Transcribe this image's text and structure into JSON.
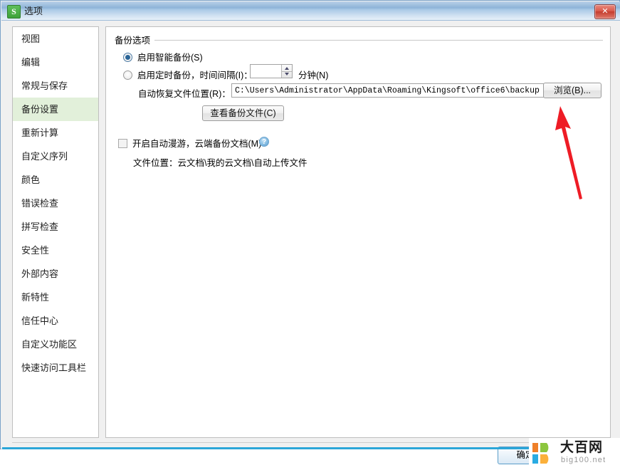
{
  "window": {
    "title": "选项",
    "app_icon": "S",
    "close_label": "✕"
  },
  "sidebar": {
    "items": [
      {
        "label": "视图",
        "selected": false
      },
      {
        "label": "编辑",
        "selected": false
      },
      {
        "label": "常规与保存",
        "selected": false
      },
      {
        "label": "备份设置",
        "selected": true
      },
      {
        "label": "重新计算",
        "selected": false
      },
      {
        "label": "自定义序列",
        "selected": false
      },
      {
        "label": "颜色",
        "selected": false
      },
      {
        "label": "错误检查",
        "selected": false
      },
      {
        "label": "拼写检查",
        "selected": false
      },
      {
        "label": "安全性",
        "selected": false
      },
      {
        "label": "外部内容",
        "selected": false
      },
      {
        "label": "新特性",
        "selected": false
      },
      {
        "label": "信任中心",
        "selected": false
      },
      {
        "label": "自定义功能区",
        "selected": false
      },
      {
        "label": "快速访问工具栏",
        "selected": false
      }
    ]
  },
  "main": {
    "group_title": "备份选项",
    "smart_backup": {
      "label": "启用智能备份(S)",
      "checked": true
    },
    "timed_backup": {
      "label": "启用定时备份，时间间隔(I)：",
      "checked": false,
      "interval_value": "",
      "unit_label": "分钟(N)"
    },
    "recovery_location": {
      "label": "自动恢复文件位置(R)：",
      "path": "C:\\Users\\Administrator\\AppData\\Roaming\\Kingsoft\\office6\\backup",
      "browse_label": "浏览(B)..."
    },
    "view_backup_button": "查看备份文件(C)",
    "cloud_roaming": {
      "label": "开启自动漫游，云端备份文档(M)",
      "checked": false,
      "help_glyph": "?"
    },
    "cloud_location": "文件位置：云文档\\我的云文档\\自动上传文件"
  },
  "footer": {
    "ok_label": "确定"
  },
  "watermark": {
    "cn_text": "大百网",
    "en_text": "big100.net",
    "colors": {
      "orange": "#ef7f29",
      "green": "#8cc63e",
      "blue": "#29abe2",
      "yellow": "#fbb03b"
    }
  },
  "annotation": {
    "arrow_color": "#ee1c25"
  },
  "colors": {
    "selected_sidebar": "#e2f0da",
    "title_blue": "#8eb4d8",
    "close_red": "#c43c2e",
    "accent_bottom": "#2ba6d8"
  }
}
